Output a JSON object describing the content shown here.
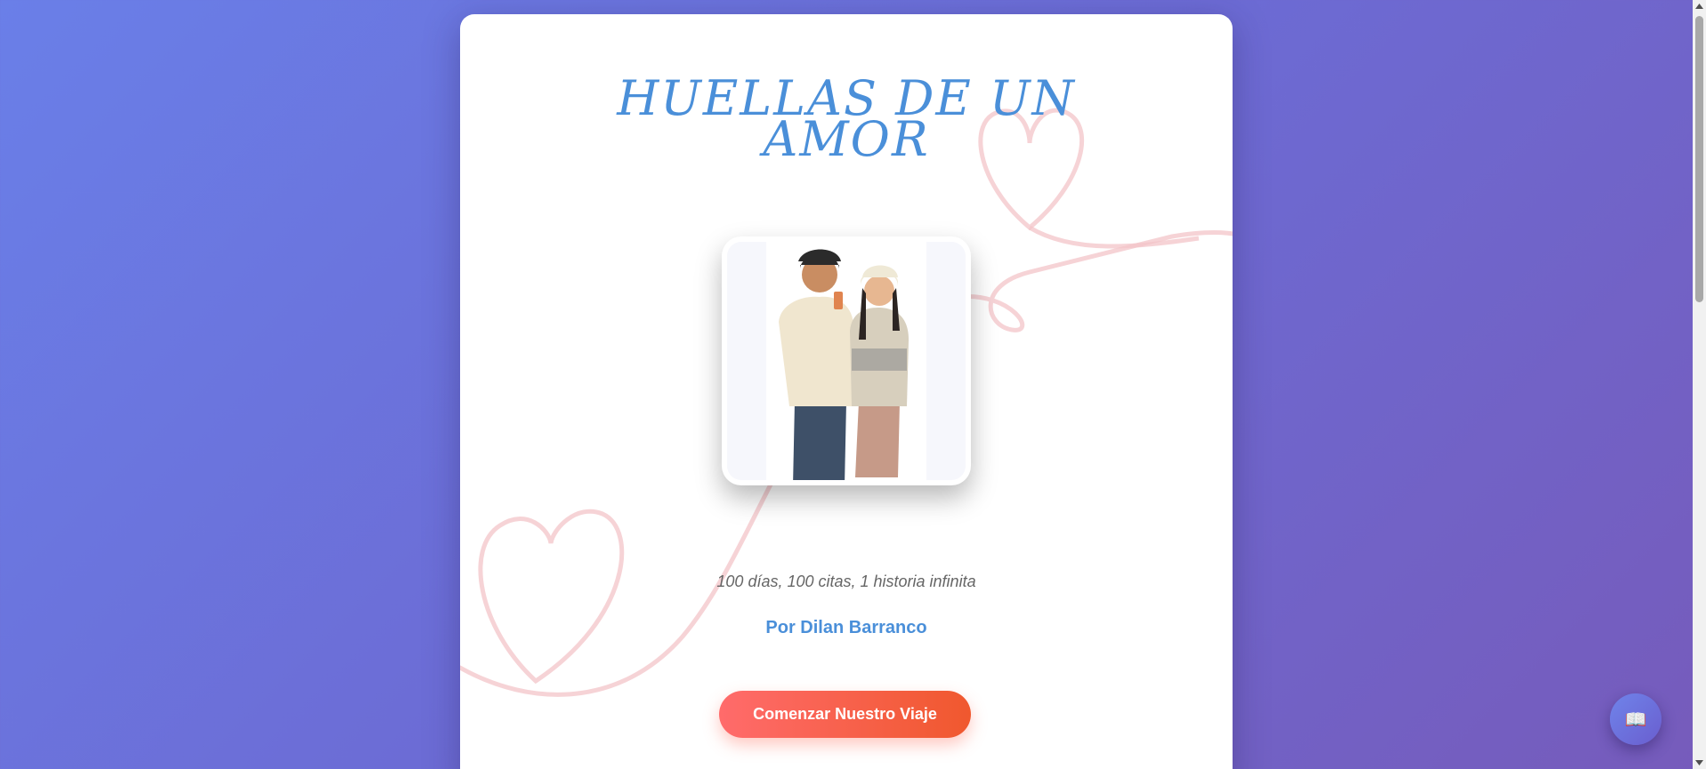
{
  "page": {
    "title_line1": "HUELLAS DE UN",
    "title_line2": "AMOR",
    "tagline": "100 días, 100 citas, 1 historia infinita",
    "author": "Por Dilan Barranco",
    "start_button_label": "Comenzar Nuestro Viaje"
  },
  "fab": {
    "icon": "book-icon",
    "glyph": "📖"
  },
  "colors": {
    "accent_blue": "#4a8fd9",
    "button_start": "#ff6b6b",
    "button_end": "#f0582e",
    "heart_line": "#f3c4c8",
    "background_start": "#6a7fe8",
    "background_end": "#765bbb"
  }
}
